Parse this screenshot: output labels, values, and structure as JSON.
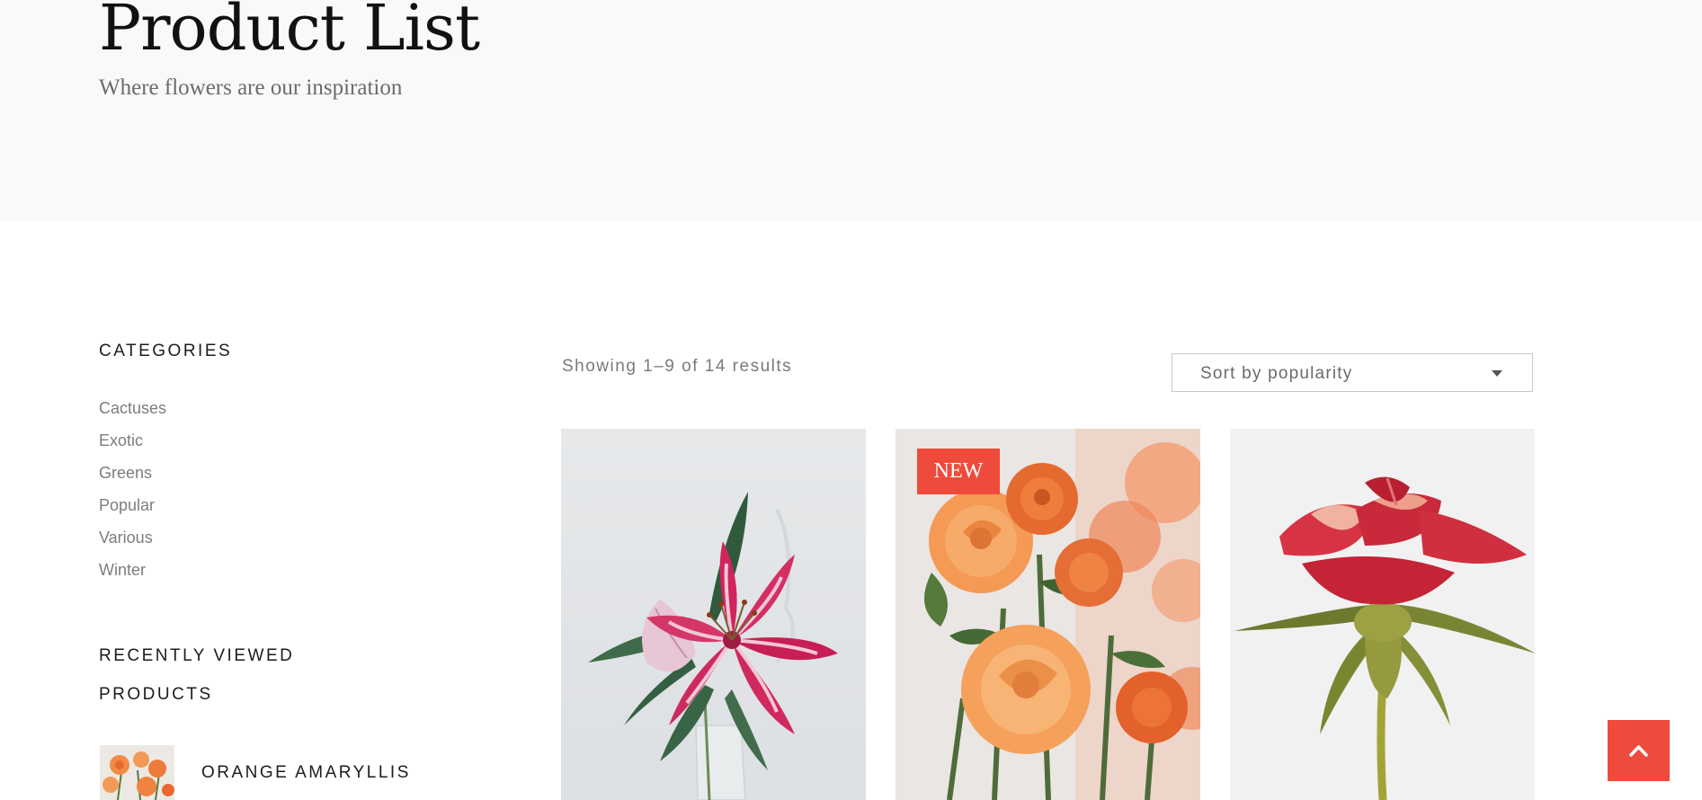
{
  "header": {
    "title": "Product List",
    "subtitle": "Where flowers are our inspiration"
  },
  "sidebar": {
    "categories_heading": "CATEGORIES",
    "categories": [
      "Cactuses",
      "Exotic",
      "Greens",
      "Popular",
      "Various",
      "Winter"
    ],
    "recent_heading_line1": "RECENTLY VIEWED",
    "recent_heading_line2": "PRODUCTS",
    "recent_products": [
      {
        "name": "ORANGE AMARYLLIS"
      }
    ]
  },
  "shop": {
    "results_text": "Showing 1–9 of 14 results",
    "sort_selected": "Sort by popularity"
  },
  "products": [
    {
      "image": "pink-lily-photo",
      "badge": ""
    },
    {
      "image": "orange-roses-photo",
      "badge": "NEW"
    },
    {
      "image": "red-rose-photo",
      "badge": ""
    }
  ],
  "colors": {
    "accent": "#ef4b3c",
    "hero_background": "#f9f9f7",
    "text_dark": "#1c1c1c",
    "text_muted": "#7d7d7d"
  },
  "icons": {
    "sort_dropdown": "caret-down-icon",
    "back_to_top": "chevron-up-icon"
  }
}
